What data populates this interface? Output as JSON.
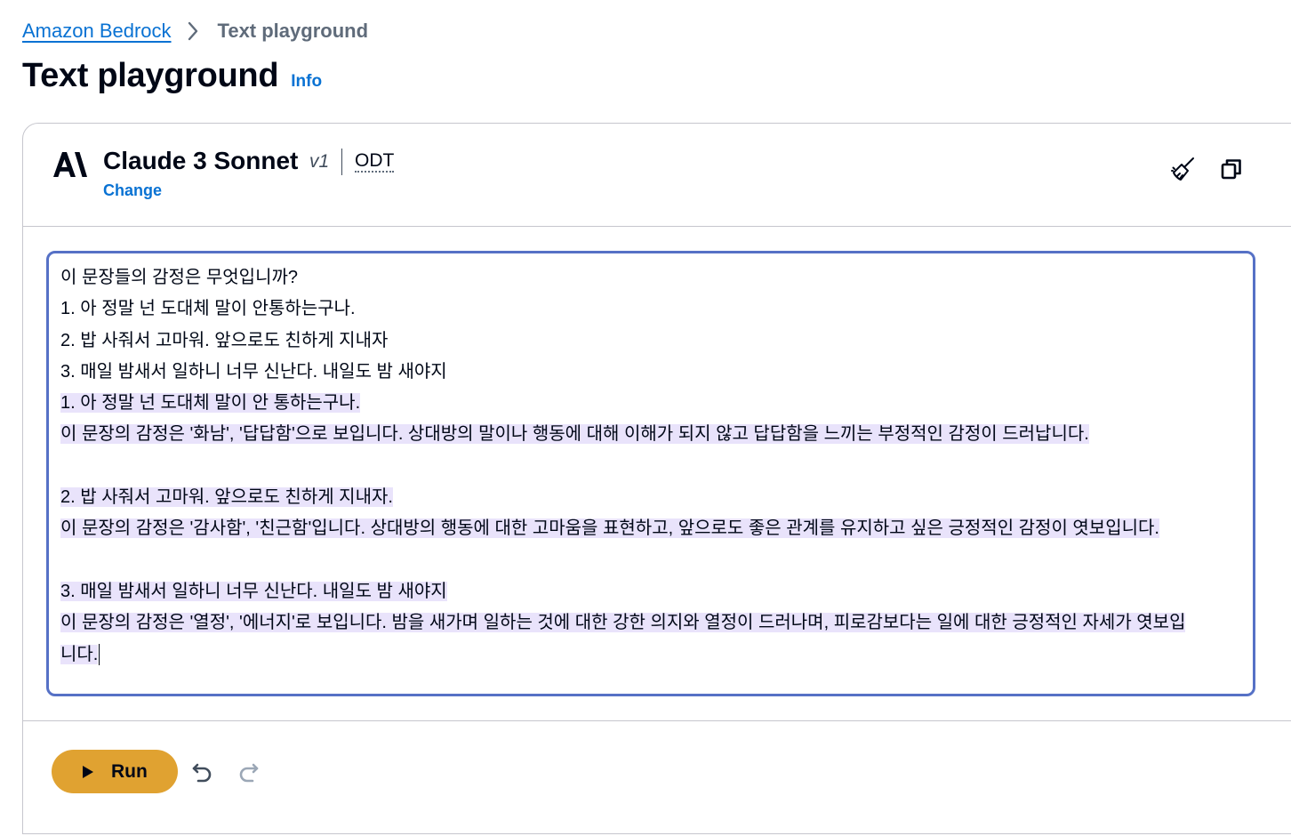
{
  "breadcrumb": {
    "root": "Amazon Bedrock",
    "current": "Text playground",
    "separator_icon": "chevron-right-icon"
  },
  "page": {
    "title": "Text playground",
    "info_label": "Info"
  },
  "model": {
    "vendor_logo": "anthropic-logo",
    "name": "Claude 3 Sonnet",
    "version": "v1",
    "mode": "ODT",
    "change_label": "Change"
  },
  "header_actions": {
    "clear_icon": "broom-icon",
    "copy_icon": "copy-icon"
  },
  "editor": {
    "lines": [
      "이 문장들의 감정은 무엇입니까?",
      "1. 아 정말 넌 도대체 말이 안통하는구나.",
      "2. 밥 사줘서 고마워. 앞으로도 친하게 지내자",
      "3. 매일 밤새서 일하니 너무 신난다. 내일도 밤 새야지",
      "1. 아 정말 넌 도대체 말이 안 통하는구나.",
      "이 문장의 감정은 '화남', '답답함'으로 보입니다. 상대방의 말이나 행동에 대해 이해가 되지 않고 답답함을 느끼는 부정적인 감정이 드러납니다.",
      "",
      "2. 밥 사줘서 고마워. 앞으로도 친하게 지내자.",
      "이 문장의 감정은 '감사함', '친근함'입니다. 상대방의 행동에 대한 고마움을 표현하고, 앞으로도 좋은 관계를 유지하고 싶은 긍정적인 감정이 엿보입니다.",
      "",
      "3. 매일 밤새서 일하니 너무 신난다. 내일도 밤 새야지",
      "이 문장의 감정은 '열정', '에너지'로 보입니다. 밤을 새가며 일하는 것에 대한 강한 의지와 열정이 드러나며, 피로감보다는 일에 대한 긍정적인 자세가 엿보입",
      "니다."
    ]
  },
  "footer": {
    "run_label": "Run",
    "run_icon": "play-icon",
    "undo_icon": "undo-icon",
    "redo_icon": "redo-icon"
  },
  "colors": {
    "link": "#0972d3",
    "run_button": "#e0a231",
    "editor_border": "#5671c6",
    "response_highlight": "#e9e3fb"
  }
}
